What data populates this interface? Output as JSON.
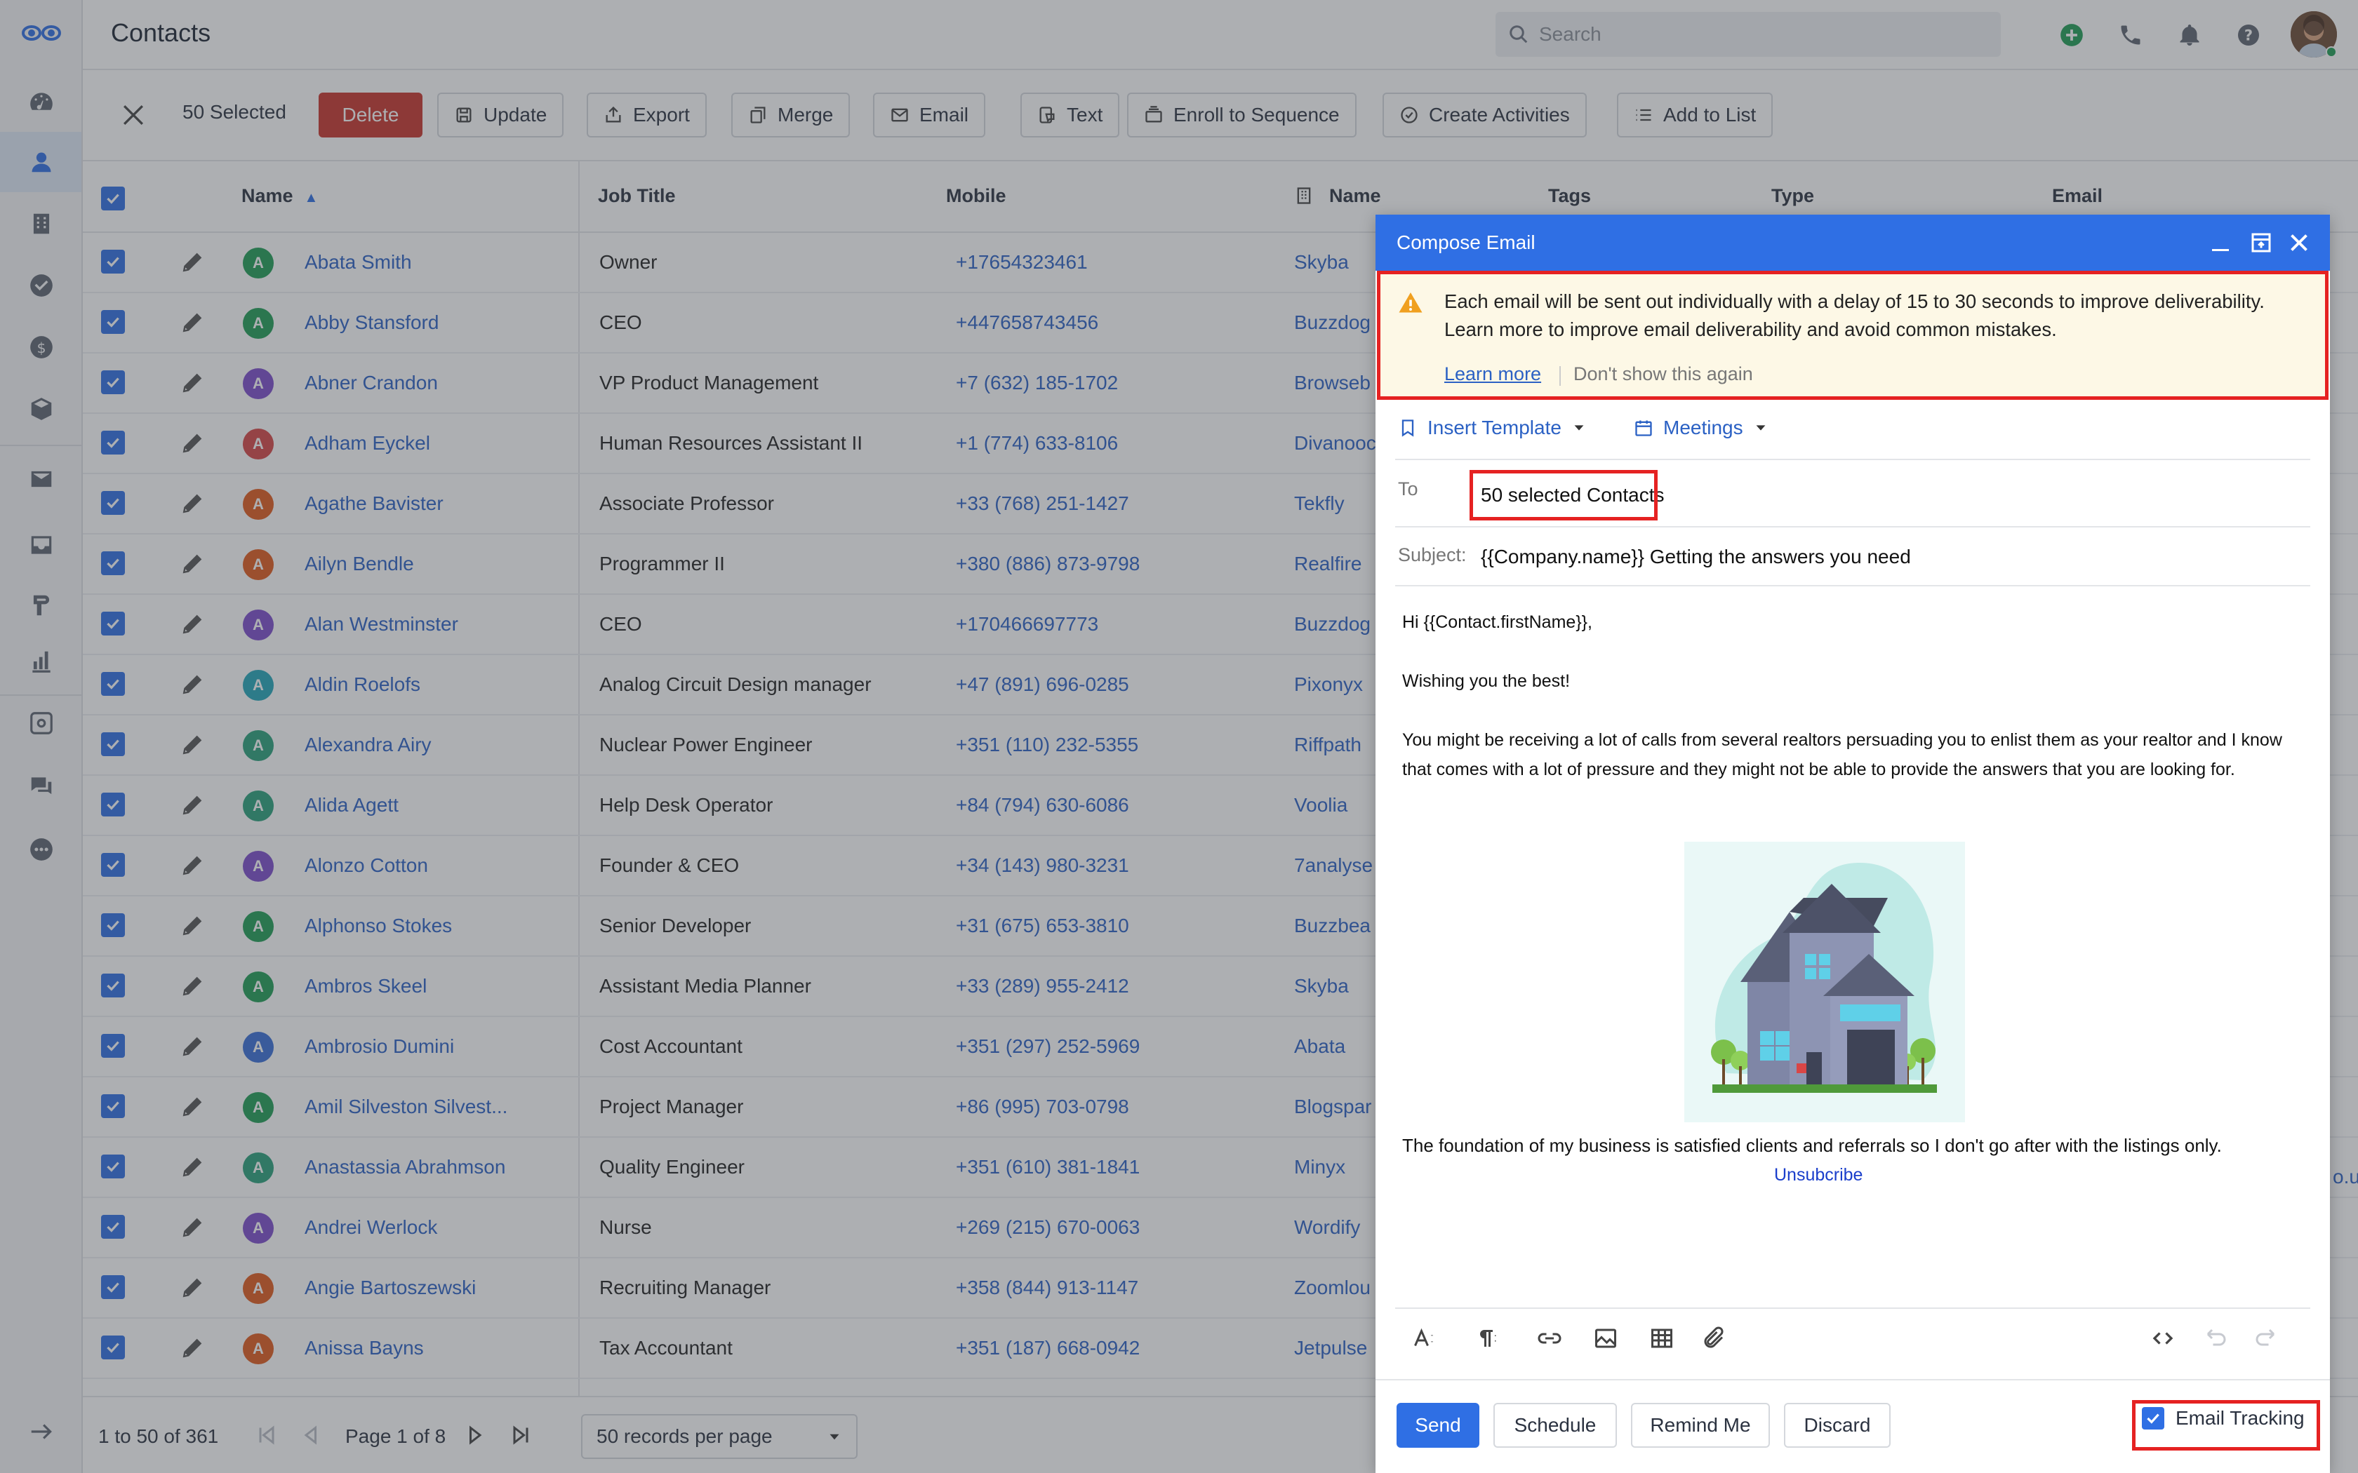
{
  "topbar": {
    "title": "Contacts",
    "search_placeholder": "Search"
  },
  "bulkbar": {
    "selected_label": "50 Selected",
    "buttons": [
      "Delete",
      "Update",
      "Export",
      "Merge",
      "Email",
      "Text",
      "Enroll to Sequence",
      "Create Activities",
      "Add to List"
    ]
  },
  "table": {
    "headers": {
      "name": "Name",
      "job_title": "Job Title",
      "mobile": "Mobile",
      "company_name": "Name",
      "tags": "Tags",
      "type": "Type",
      "email": "Email"
    },
    "rows": [
      {
        "initial": "A",
        "color": "#1f9d55",
        "name": "Abata Smith",
        "title": "Owner",
        "mobile": "+17654323461",
        "company": "Skyba"
      },
      {
        "initial": "A",
        "color": "#1f9d55",
        "name": "Abby Stansford",
        "title": "CEO",
        "mobile": "+447658743456",
        "company": "Buzzdog"
      },
      {
        "initial": "A",
        "color": "#7c4dcc",
        "name": "Abner Crandon",
        "title": "VP Product Management",
        "mobile": "+7 (632) 185-1702",
        "company": "Browseb"
      },
      {
        "initial": "A",
        "color": "#d64545",
        "name": "Adham Eyckel",
        "title": "Human Resources Assistant II",
        "mobile": "+1 (774) 633-8106",
        "company": "Divanooc"
      },
      {
        "initial": "A",
        "color": "#e05a1c",
        "name": "Agathe Bavister",
        "title": "Associate Professor",
        "mobile": "+33 (768) 251-1427",
        "company": "Tekfly"
      },
      {
        "initial": "A",
        "color": "#e05a1c",
        "name": "Ailyn Bendle",
        "title": "Programmer II",
        "mobile": "+380 (886) 873-9798",
        "company": "Realfire"
      },
      {
        "initial": "A",
        "color": "#7c4dcc",
        "name": "Alan Westminster",
        "title": "CEO",
        "mobile": "+170466697773",
        "company": "Buzzdog"
      },
      {
        "initial": "A",
        "color": "#23a6b8",
        "name": "Aldin Roelofs",
        "title": "Analog Circuit Design manager",
        "mobile": "+47 (891) 696-0285",
        "company": "Pixonyx"
      },
      {
        "initial": "A",
        "color": "#2aa07a",
        "name": "Alexandra Airy",
        "title": "Nuclear Power Engineer",
        "mobile": "+351 (110) 232-5355",
        "company": "Riffpath"
      },
      {
        "initial": "A",
        "color": "#2aa07a",
        "name": "Alida Agett",
        "title": "Help Desk Operator",
        "mobile": "+84 (794) 630-6086",
        "company": "Voolia"
      },
      {
        "initial": "A",
        "color": "#7c4dcc",
        "name": "Alonzo Cotton",
        "title": "Founder & CEO",
        "mobile": "+34 (143) 980-3231",
        "company": "7analyse"
      },
      {
        "initial": "A",
        "color": "#1f9d55",
        "name": "Alphonso Stokes",
        "title": "Senior Developer",
        "mobile": "+31 (675) 653-3810",
        "company": "Buzzbea"
      },
      {
        "initial": "A",
        "color": "#1f9d55",
        "name": "Ambros Skeel",
        "title": "Assistant Media Planner",
        "mobile": "+33 (289) 955-2412",
        "company": "Skyba"
      },
      {
        "initial": "A",
        "color": "#3a6fd8",
        "name": "Ambrosio Dumini",
        "title": "Cost Accountant",
        "mobile": "+351 (297) 252-5969",
        "company": "Abata"
      },
      {
        "initial": "A",
        "color": "#1f9d55",
        "name": "Amil Silveston Silvest...",
        "title": "Project Manager",
        "mobile": "+86 (995) 703-0798",
        "company": "Blogspar"
      },
      {
        "initial": "A",
        "color": "#2aa07a",
        "name": "Anastassia Abrahmson",
        "title": "Quality Engineer",
        "mobile": "+351 (610) 381-1841",
        "company": "Minyx"
      },
      {
        "initial": "A",
        "color": "#7c4dcc",
        "name": "Andrei Werlock",
        "title": "Nurse",
        "mobile": "+269 (215) 670-0063",
        "company": "Wordify"
      },
      {
        "initial": "A",
        "color": "#e05a1c",
        "name": "Angie Bartoszewski",
        "title": "Recruiting Manager",
        "mobile": "+358 (844) 913-1147",
        "company": "Zoomlou"
      },
      {
        "initial": "A",
        "color": "#e05a1c",
        "name": "Anissa Bayns",
        "title": "Tax Accountant",
        "mobile": "+351 (187) 668-0942",
        "company": "Jetpulse"
      }
    ],
    "email_fragment": "o.uk"
  },
  "pager": {
    "range": "1 to 50 of 361",
    "page": "Page 1 of 8",
    "per_page": "50 records per page"
  },
  "compose": {
    "title": "Compose Email",
    "alert_text": "Each email will be sent out individually with a delay of 15 to 30 seconds to improve deliverability. Learn more to improve email deliverability and avoid common mistakes.",
    "learn_more": "Learn more",
    "dont_show": "Don't show this again",
    "insert_template": "Insert Template",
    "meetings": "Meetings",
    "to_label": "To",
    "to_value": "50 selected Contacts",
    "subject_label": "Subject:",
    "subject_value": "{{Company.name}} Getting the answers you need",
    "body": {
      "greeting": "Hi {{Contact.firstName}},",
      "wish": "Wishing you the best!",
      "para": "You might be receiving a lot of calls from several realtors persuading you to enlist them as your realtor and I know that comes with a lot of pressure and they might not be able to provide the answers that you are looking for.",
      "closing": "The foundation of my business is satisfied clients and referrals so I don't go after with the listings only.",
      "unsubscribe": "Unsubcribe"
    },
    "buttons": {
      "send": "Send",
      "schedule": "Schedule",
      "remind": "Remind Me",
      "discard": "Discard"
    },
    "tracking_label": "Email Tracking"
  },
  "colors": {
    "primary": "#2f6fe4",
    "delete": "#c9352b",
    "highlight": "#e52222",
    "alert_bg": "#fdf8e6"
  }
}
